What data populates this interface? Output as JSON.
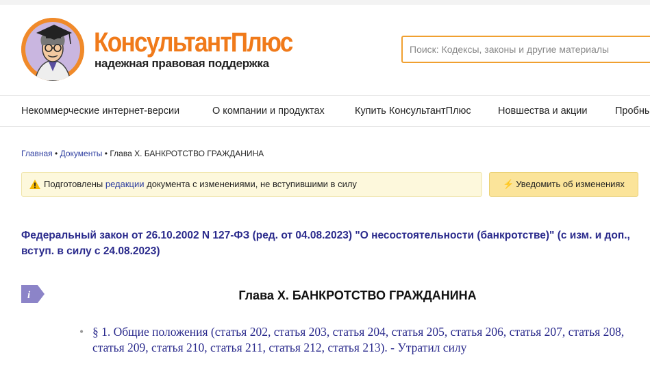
{
  "header": {
    "brand": "КонсультантПлюс",
    "tagline": "надежная правовая поддержка",
    "search_placeholder": "Поиск: Кодексы, законы и другие материалы"
  },
  "nav": {
    "items": [
      {
        "label": "Некоммерческие интернет-версии"
      },
      {
        "label": "О компании и продуктах"
      },
      {
        "label": "Купить КонсультантПлюс"
      },
      {
        "label": "Новшества и акции"
      },
      {
        "label": "Пробны"
      }
    ]
  },
  "breadcrumb": {
    "home": "Главная",
    "sep": "•",
    "documents": "Документы",
    "current": "Глава X. БАНКРОТСТВО ГРАЖДАНИНА"
  },
  "notice": {
    "text_before": "Подготовлены ",
    "link": "редакции",
    "text_after": " документа с изменениями, не вступившими в силу",
    "button_icon": "⚡",
    "button_label": "Уведомить об изменениях"
  },
  "document": {
    "title": "Федеральный закон от 26.10.2002 N 127-ФЗ (ред. от 04.08.2023) \"О несостоятельности (банкротстве)\" (с изм. и доп., вступ. в силу с 24.08.2023)",
    "chapter": "Глава X. БАНКРОТСТВО ГРАЖДАНИНА",
    "items": [
      {
        "text": "§ 1. Общие положения (статья 202, статья 203, статья 204, статья 205, статья 206, статья 207, статья 208, статья 209, статья 210, статья 211, статья 212, статья 213). - Утратил силу"
      }
    ]
  },
  "colors": {
    "brand_orange": "#f07a1a",
    "link_blue": "#2f3fa0",
    "title_blue": "#2a2a8c",
    "notice_bg": "#fdf8dc",
    "button_bg": "#fbe49a"
  }
}
